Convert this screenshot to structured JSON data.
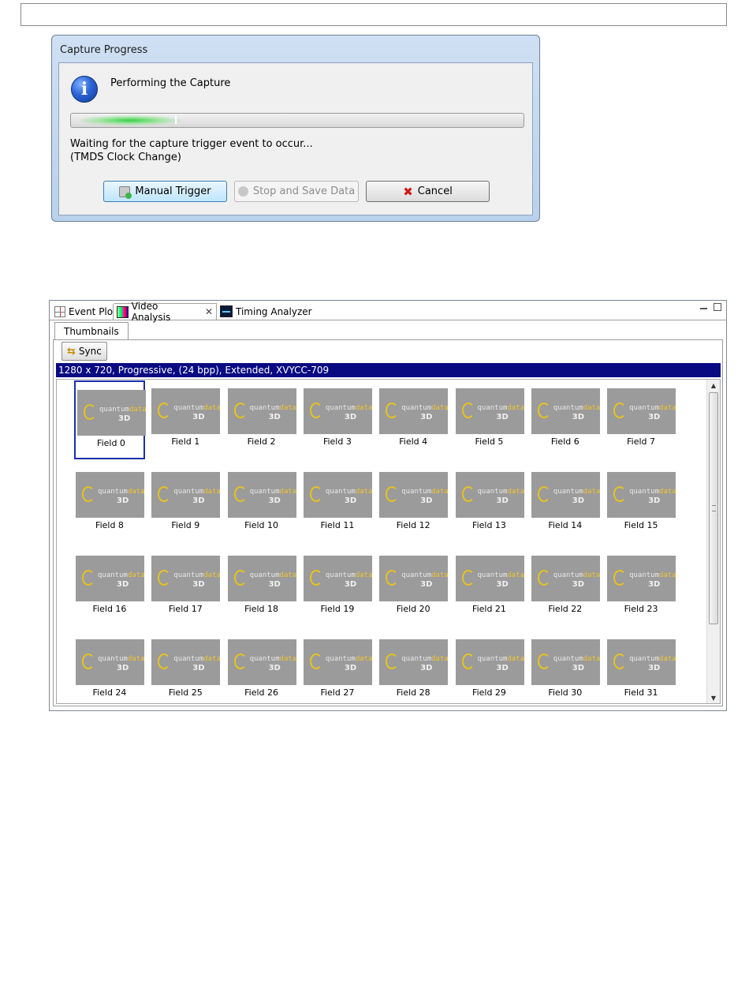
{
  "dialog": {
    "title": "Capture Progress",
    "heading": "Performing the Capture",
    "info_icon_glyph": "i",
    "status_line1": "Waiting for the capture trigger event to occur...",
    "status_line2": "(TMDS Clock Change)",
    "buttons": {
      "manual_trigger": "Manual Trigger",
      "stop_and_save": "Stop and Save Data",
      "cancel": "Cancel",
      "cancel_icon": "✖"
    }
  },
  "workbench": {
    "tabs": [
      {
        "label": "Event Plot",
        "icon": "event-plot-icon"
      },
      {
        "label": "Video Analysis",
        "icon": "video-analysis-icon",
        "close": "✕"
      },
      {
        "label": "Timing Analyzer",
        "icon": "timing-analyzer-icon"
      }
    ],
    "subtab": "Thumbnails",
    "sync_label": "Sync",
    "sync_icon": "⇆",
    "format": "1280 x 720, Progressive, (24 bpp), Extended, XVYCC-709",
    "scroll_up": "▲",
    "scroll_down": "▼",
    "logo": {
      "quantum": "quantum",
      "data": "data",
      "three_d": "3D"
    },
    "fields": [
      "Field 0",
      "Field 1",
      "Field 2",
      "Field 3",
      "Field 4",
      "Field 5",
      "Field 6",
      "Field 7",
      "Field 8",
      "Field 9",
      "Field 10",
      "Field 11",
      "Field 12",
      "Field 13",
      "Field 14",
      "Field 15",
      "Field 16",
      "Field 17",
      "Field 18",
      "Field 19",
      "Field 20",
      "Field 21",
      "Field 22",
      "Field 23",
      "Field 24",
      "Field 25",
      "Field 26",
      "Field 27",
      "Field 28",
      "Field 29",
      "Field 30",
      "Field 31"
    ],
    "selected_field": 0
  }
}
